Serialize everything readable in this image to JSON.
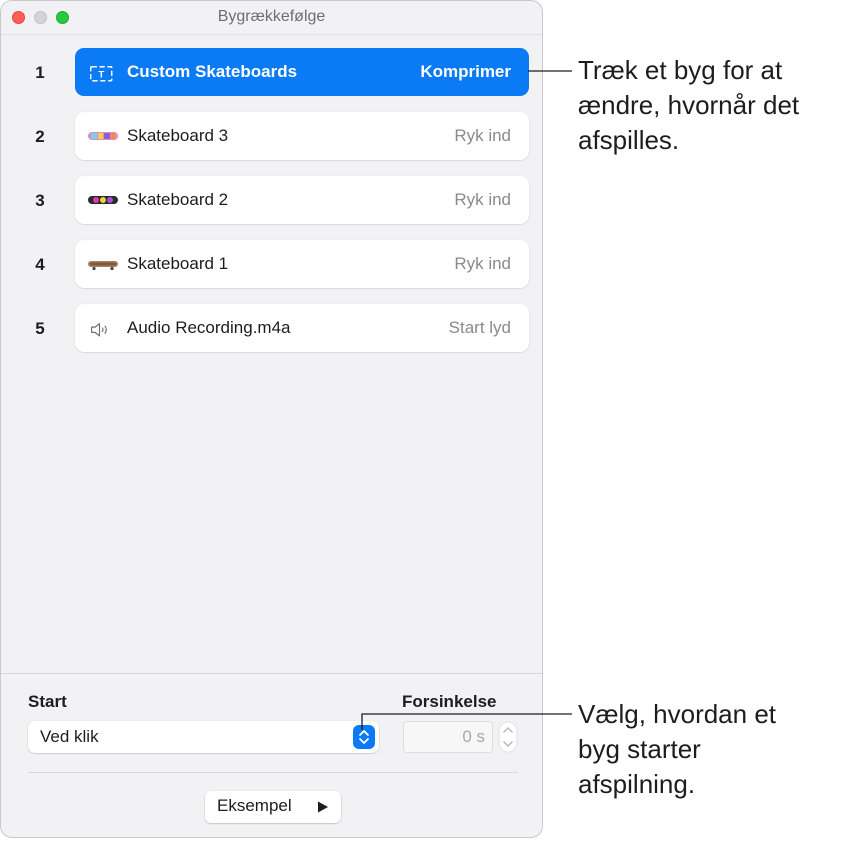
{
  "window": {
    "title": "Bygrækkefølge"
  },
  "builds": [
    {
      "number": "1",
      "label": "Custom Skateboards",
      "effect": "Komprimer",
      "selected": true,
      "icon": "text-box-icon"
    },
    {
      "number": "2",
      "label": "Skateboard 3",
      "effect": "Ryk ind",
      "selected": false,
      "icon": "skateboard-thumbnail"
    },
    {
      "number": "3",
      "label": "Skateboard 2",
      "effect": "Ryk ind",
      "selected": false,
      "icon": "skateboard-thumbnail"
    },
    {
      "number": "4",
      "label": "Skateboard 1",
      "effect": "Ryk ind",
      "selected": false,
      "icon": "skateboard-thumbnail"
    },
    {
      "number": "5",
      "label": "Audio Recording.m4a",
      "effect": "Start lyd",
      "selected": false,
      "icon": "speaker-icon"
    }
  ],
  "panel": {
    "start_label": "Start",
    "start_value": "Ved klik",
    "delay_label": "Forsinkelse",
    "delay_value": "0 s",
    "preview_label": "Eksempel"
  },
  "callouts": {
    "top": "Træk et byg for at ændre, hvornår det afspilles.",
    "bottom": "Vælg, hvordan et byg starter afspilning."
  },
  "colors": {
    "accent": "#0a7bf5",
    "close": "#ff5f57",
    "maximize": "#28c840"
  }
}
